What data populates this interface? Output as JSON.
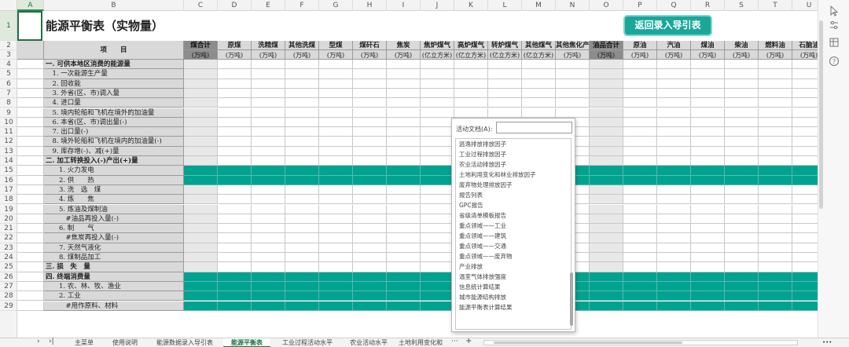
{
  "columns": [
    "A",
    "B",
    "C",
    "D",
    "E",
    "F",
    "G",
    "H",
    "I",
    "J",
    "K",
    "L",
    "M",
    "N",
    "O",
    "P",
    "Q",
    "R",
    "S",
    "T",
    "U"
  ],
  "selected_column": "A",
  "selected_row": "1",
  "title": "能源平衡表（实物量）",
  "return_button": "返回录入导引表",
  "header_item": "项　　目",
  "headers": [
    {
      "name": "煤合计",
      "unit": "(万吨)",
      "dark": true
    },
    {
      "name": "原煤",
      "unit": "(万吨)"
    },
    {
      "name": "洗精煤",
      "unit": "(万吨)"
    },
    {
      "name": "其他洗煤",
      "unit": "(万吨)"
    },
    {
      "name": "型煤",
      "unit": "(万吨)"
    },
    {
      "name": "煤矸石",
      "unit": "(万吨)"
    },
    {
      "name": "焦炭",
      "unit": "(万吨)"
    },
    {
      "name": "焦炉煤气",
      "unit": "(亿立方米)"
    },
    {
      "name": "高炉煤气",
      "unit": "(亿立方米)"
    },
    {
      "name": "转炉煤气",
      "unit": "(亿立方米)"
    },
    {
      "name": "其他煤气",
      "unit": "(亿立方米)"
    },
    {
      "name": "其他焦化产品",
      "unit": "(万吨)"
    },
    {
      "name": "油品合计",
      "unit": "(万吨)",
      "dark": true
    },
    {
      "name": "原油",
      "unit": "(万吨)"
    },
    {
      "name": "汽油",
      "unit": "(万吨)"
    },
    {
      "name": "煤油",
      "unit": "(万吨)"
    },
    {
      "name": "柴油",
      "unit": "(万吨)"
    },
    {
      "name": "燃料油",
      "unit": "(万吨)"
    },
    {
      "name": "石脑油",
      "unit": "(万吨)"
    }
  ],
  "rows": [
    {
      "num": "4",
      "label": "一. 可供本地区消费的能源量",
      "bold": true
    },
    {
      "num": "5",
      "label": "　1. 一次能源生产量"
    },
    {
      "num": "6",
      "label": "　2. 回收能"
    },
    {
      "num": "7",
      "label": "　3. 外省(区、市)调入量"
    },
    {
      "num": "8",
      "label": "　4. 进口量"
    },
    {
      "num": "9",
      "label": "　5. 境内轮船和飞机在境外的加油量"
    },
    {
      "num": "10",
      "label": "　6. 本省(区、市)调出量(-)"
    },
    {
      "num": "11",
      "label": "　7. 出口量(-)"
    },
    {
      "num": "12",
      "label": "　8. 境外轮船和飞机在境内的加油量(-)"
    },
    {
      "num": "13",
      "label": "　9. 库存增(-)、减(+)量"
    },
    {
      "num": "14",
      "label": "二. 加工转换投入(-)产出(+)量",
      "bold": true
    },
    {
      "num": "15",
      "label": "　　1. 火力发电",
      "teal": true
    },
    {
      "num": "16",
      "label": "　　2. 供　　热",
      "teal": true
    },
    {
      "num": "17",
      "label": "　　3. 洗　选　煤"
    },
    {
      "num": "18",
      "label": "　　4. 炼　　焦"
    },
    {
      "num": "19",
      "label": "　　5. 炼油及煤制油"
    },
    {
      "num": "20",
      "label": "　　　#油品再投入量(-)"
    },
    {
      "num": "21",
      "label": "　　6. 制　　气"
    },
    {
      "num": "22",
      "label": "　　　#焦炭再投入量(-)"
    },
    {
      "num": "23",
      "label": "　　7. 天然气液化"
    },
    {
      "num": "24",
      "label": "　　8. 煤制品加工"
    },
    {
      "num": "25",
      "label": "三. 损　失　量",
      "bold": true
    },
    {
      "num": "26",
      "label": "四. 终端消费量",
      "bold": true,
      "teal": true
    },
    {
      "num": "27",
      "label": "　　1. 农、林、牧、渔业",
      "teal": true
    },
    {
      "num": "28",
      "label": "　　2. 工业",
      "teal": true
    },
    {
      "num": "29",
      "label": "　　　#用作原料、材料",
      "teal": true
    }
  ],
  "popup": {
    "label": "活动文档(A):",
    "input_value": "",
    "items": [
      "逃逸排放排放因子",
      "工业过程排放因子",
      "农业活动排放因子",
      "土地利用变化和林业排放因子",
      "废弃物处理排放因子",
      "报告列表",
      "GPC报告",
      "省级清单模板报告",
      "重点领域——工业",
      "重点领域——建筑",
      "重点领域——交通",
      "重点领域——废弃物",
      "产业排放",
      "温室气体排放强度",
      "信息统计算结果",
      "城市能源结构排放",
      "能源平衡表计算结果"
    ]
  },
  "tabs": [
    "主菜单",
    "使用说明",
    "能源数据录入导引表",
    "能源平衡表",
    "工业过程活动水平",
    "农业活动水平",
    "土地利用变化和"
  ],
  "active_tab": "能源平衡表",
  "tab_more": "···",
  "tab_add": "+",
  "nav_next": "›",
  "nav_last": "›|",
  "dots": "•••",
  "colors": {
    "teal": "#00a390",
    "header_gray": "#d9d9d9",
    "dark_header": "#8c8c8c",
    "accent_green": "#1e7145",
    "button": "#1aa79a"
  }
}
